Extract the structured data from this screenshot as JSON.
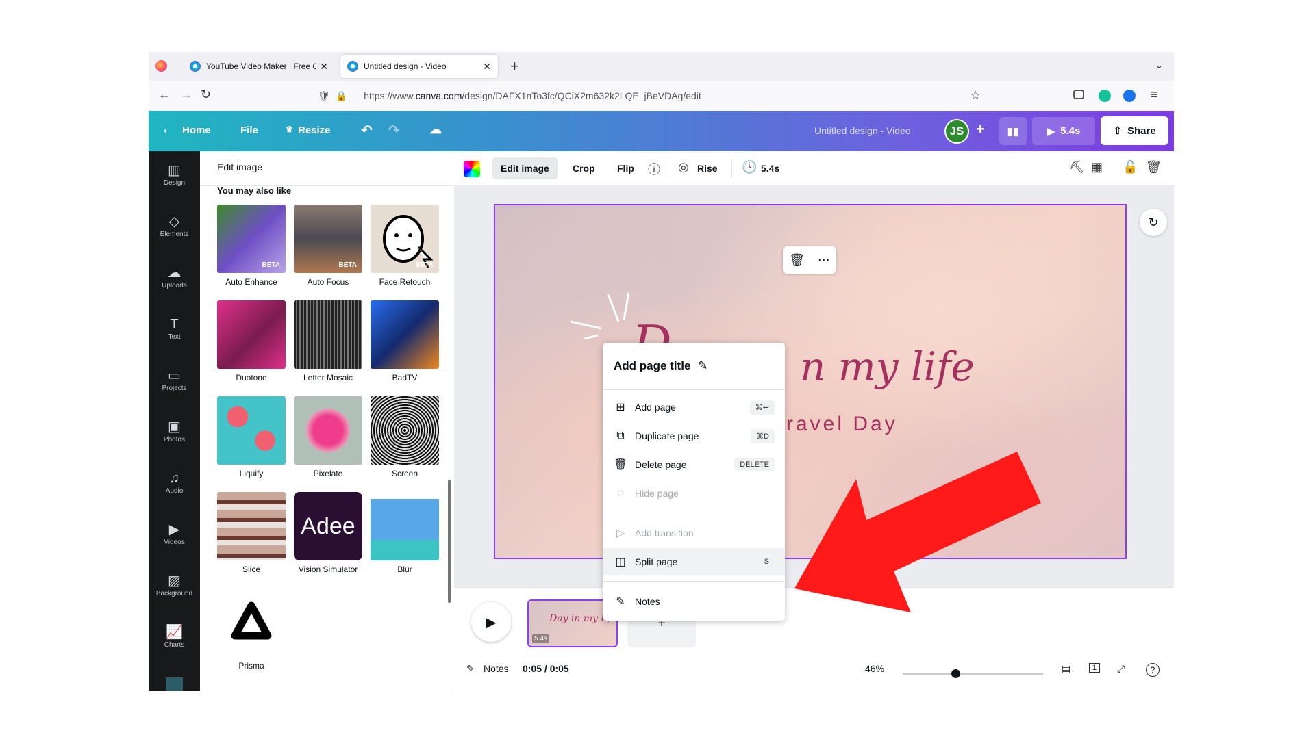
{
  "browser": {
    "tabs": [
      {
        "title": "YouTube Video Maker | Free Onl",
        "active": false
      },
      {
        "title": "Untitled design - Video",
        "active": true
      }
    ],
    "url_prefix": "https://www.",
    "url_domain": "canva.com",
    "url_path": "/design/DAFX1nTo3fc/QCiX2m632k2LQE_jBeVDAg/edit"
  },
  "header": {
    "home": "Home",
    "file": "File",
    "resize": "Resize",
    "doc_title": "Untitled design - Video",
    "avatar": "JS",
    "duration": "5.4s",
    "share": "Share"
  },
  "rail": [
    {
      "label": "Design",
      "icon": "design-icon"
    },
    {
      "label": "Elements",
      "icon": "elements-icon"
    },
    {
      "label": "Uploads",
      "icon": "uploads-icon"
    },
    {
      "label": "Text",
      "icon": "text-icon"
    },
    {
      "label": "Projects",
      "icon": "projects-icon"
    },
    {
      "label": "Photos",
      "icon": "photos-icon"
    },
    {
      "label": "Audio",
      "icon": "audio-icon"
    },
    {
      "label": "Videos",
      "icon": "videos-icon"
    },
    {
      "label": "Background",
      "icon": "background-icon"
    },
    {
      "label": "Charts",
      "icon": "charts-icon"
    }
  ],
  "panel": {
    "title": "Edit image",
    "subtitle": "You may also like",
    "effects": [
      {
        "label": "Auto Enhance",
        "badge": "BETA"
      },
      {
        "label": "Auto Focus",
        "badge": "BETA"
      },
      {
        "label": "Face Retouch",
        "badge": "BETA"
      },
      {
        "label": "Duotone"
      },
      {
        "label": "Letter Mosaic"
      },
      {
        "label": "BadTV"
      },
      {
        "label": "Liquify"
      },
      {
        "label": "Pixelate"
      },
      {
        "label": "Screen"
      },
      {
        "label": "Slice"
      },
      {
        "label": "Vision Simulator",
        "art": "Adee"
      },
      {
        "label": "Blur"
      },
      {
        "label": "Prisma"
      }
    ]
  },
  "toolbar": {
    "edit_image": "Edit image",
    "crop": "Crop",
    "flip": "Flip",
    "animation": "Rise",
    "timing": "5.4s"
  },
  "design": {
    "script_text": "n my life",
    "script_initial": "D",
    "subtitle": "ravel Day"
  },
  "timeline": {
    "thumb_duration": "5.4s",
    "thumb_text": "Day in my life",
    "notes": "Notes",
    "time": "0:05 / 0:05",
    "zoom": "46%",
    "page_count": "1",
    "zoom_fraction": 0.45
  },
  "menu": {
    "title": "Add page title",
    "items": [
      {
        "label": "Add page",
        "shortcut": "⌘↩"
      },
      {
        "label": "Duplicate page",
        "shortcut": "⌘D"
      },
      {
        "label": "Delete page",
        "shortcut": "DELETE"
      },
      {
        "label": "Hide page"
      },
      {
        "label": "Add transition"
      },
      {
        "label": "Split page",
        "shortcut": "S"
      },
      {
        "label": "Notes"
      }
    ]
  },
  "colors": {
    "accent": "#8b3dff",
    "arrow": "#ff1a1a",
    "script": "#a4315f"
  }
}
